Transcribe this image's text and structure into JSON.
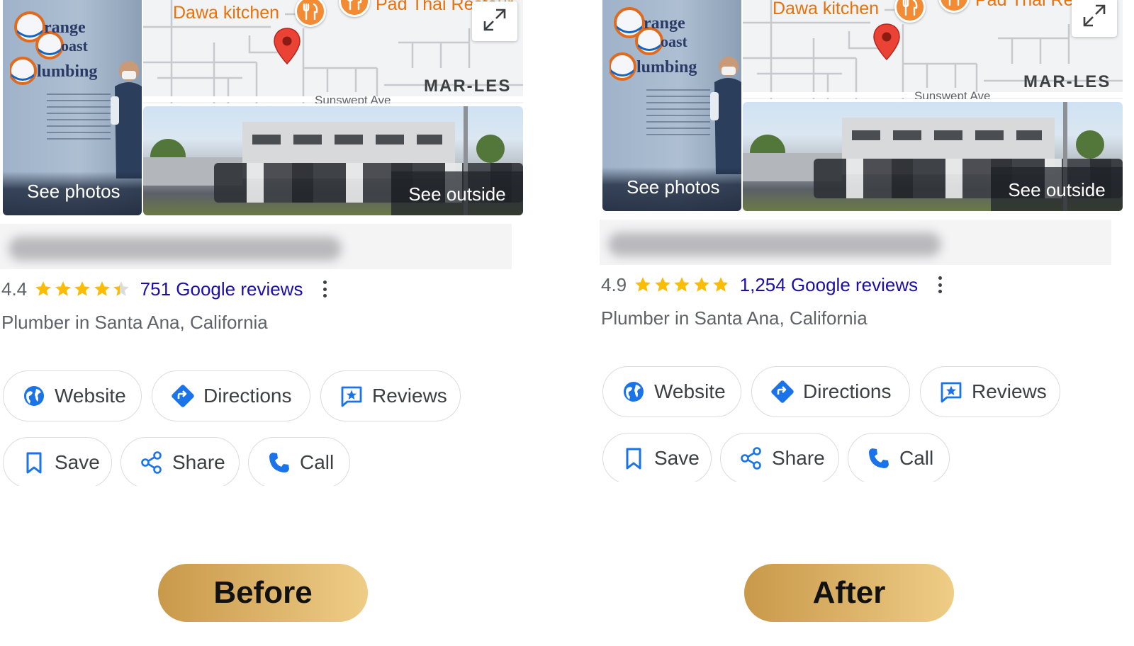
{
  "panels": [
    {
      "id": "before",
      "media": {
        "see_photos": "See photos",
        "see_outside": "See outside",
        "map_labels": [
          "Dawa kitchen",
          "Pad Thai Restaur",
          "MAR-LES",
          "Sunswept Ave"
        ],
        "truck_text": [
          "range",
          "oast",
          "lumbing"
        ]
      },
      "rating": "4.4",
      "stars_filled": 4.4,
      "reviews": "751 Google reviews",
      "category": "Plumber in Santa Ana, California",
      "buttons": {
        "website": "Website",
        "directions": "Directions",
        "reviews": "Reviews",
        "save": "Save",
        "share": "Share",
        "call": "Call"
      },
      "label": "Before"
    },
    {
      "id": "after",
      "media": {
        "see_photos": "See photos",
        "see_outside": "See outside",
        "map_labels": [
          "Dawa kitchen",
          "Pad Thai Restaur",
          "MAR-LES",
          "Sunswept Ave"
        ],
        "truck_text": [
          "range",
          "oast",
          "lumbing"
        ]
      },
      "rating": "4.9",
      "stars_filled": 4.9,
      "reviews": "1,254 Google reviews",
      "category": "Plumber in Santa Ana, California",
      "buttons": {
        "website": "Website",
        "directions": "Directions",
        "reviews": "Reviews",
        "save": "Save",
        "share": "Share",
        "call": "Call"
      },
      "label": "After"
    }
  ],
  "icons": {
    "website": "globe-icon",
    "directions": "directions-diamond-icon",
    "reviews": "review-star-bubble-icon",
    "save": "bookmark-icon",
    "share": "share-icon",
    "call": "phone-icon",
    "more": "more-vertical-icon",
    "expand": "expand-map-icon",
    "restaurant": "fork-knife-icon",
    "location": "map-pin-icon"
  },
  "colors": {
    "link": "#1a0dab",
    "star": "#fbbc04",
    "star_empty": "#dadce0",
    "icon_blue": "#1a73e8",
    "pin_red": "#ea4335",
    "food_orange": "#f28b34",
    "pill_gold": "#ddb56b"
  }
}
